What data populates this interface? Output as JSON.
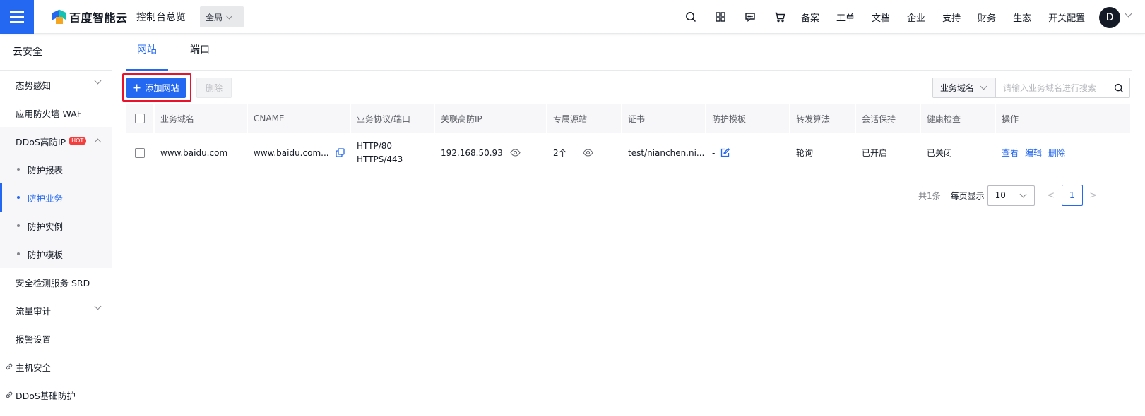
{
  "header": {
    "logo_text": "百度智能云",
    "console_title": "控制台总览",
    "region": "全局",
    "icons": [
      "search-icon",
      "apps-grid-icon",
      "message-icon",
      "cart-icon"
    ],
    "links": [
      "备案",
      "工单",
      "文档",
      "企业",
      "支持",
      "财务",
      "生态",
      "开关配置"
    ],
    "avatar_letter": "D"
  },
  "sidebar": {
    "title": "云安全",
    "items": [
      {
        "label": "态势感知"
      },
      {
        "label": "应用防火墙 WAF"
      },
      {
        "label": "DDoS高防IP",
        "badge": "HOT"
      },
      {
        "label": "防护报表"
      },
      {
        "label": "防护业务"
      },
      {
        "label": "防护实例"
      },
      {
        "label": "防护模板"
      },
      {
        "label": "安全检测服务 SRD"
      },
      {
        "label": "流量审计"
      },
      {
        "label": "报警设置"
      },
      {
        "label": "主机安全"
      },
      {
        "label": "DDoS基础防护"
      }
    ]
  },
  "tabs": [
    {
      "label": "网站"
    },
    {
      "label": "端口"
    }
  ],
  "toolbar": {
    "add_label": "添加网站",
    "delete_label": "删除",
    "search_type": "业务域名",
    "search_placeholder": "请输入业务域名进行搜索"
  },
  "table": {
    "headers": [
      "业务域名",
      "CNAME",
      "业务协议/端口",
      "关联高防IP",
      "专属源站",
      "证书",
      "防护模板",
      "转发算法",
      "会话保持",
      "健康检查",
      "操作"
    ],
    "rows": [
      {
        "domain": "www.baidu.com",
        "cname": "www.baidu.com...",
        "protocol_1": "HTTP/80",
        "protocol_2": "HTTPS/443",
        "ip": "192.168.50.93",
        "origin": "2个",
        "cert": "test/nianchen.ni...",
        "template": "-",
        "algorithm": "轮询",
        "session": "已开启",
        "health": "已关闭",
        "actions": [
          "查看",
          "编辑",
          "删除"
        ]
      }
    ]
  },
  "pagination": {
    "total": "共1条",
    "per_page_label": "每页显示",
    "per_page": "10",
    "prev": "<",
    "current": "1",
    "next": ">"
  },
  "colors": {
    "primary": "#2468f2",
    "highlight": "#e8122c",
    "hot": "#f33e3e"
  }
}
